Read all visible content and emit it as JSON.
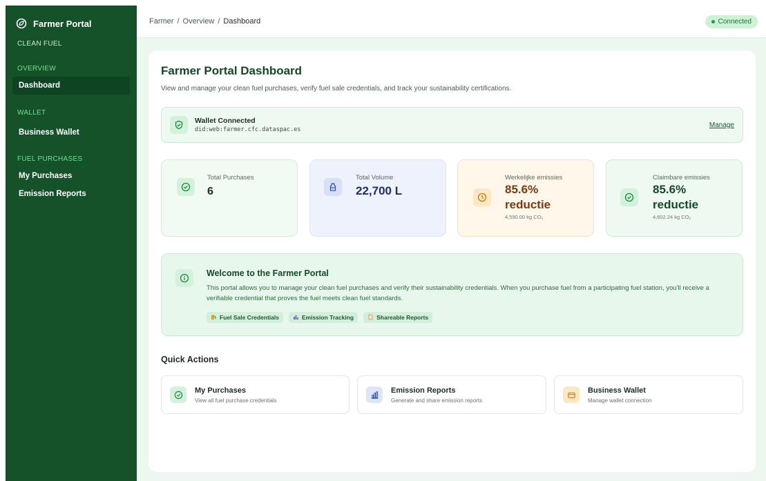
{
  "app": {
    "name": "Farmer Portal"
  },
  "colors": {
    "sidebar": "#15522a",
    "accent": "#6fe08f",
    "connected": "#1aa047",
    "volume_tint": "#eef2fd",
    "actual_emissions_tint": "#fff8ea",
    "claimable_emissions_tint": "#eefaf1"
  },
  "sidebar": {
    "top_section": "CLEAN FUEL",
    "sections": [
      {
        "label": "OVERVIEW",
        "items": [
          {
            "label": "Dashboard",
            "active": true
          }
        ]
      },
      {
        "label": "WALLET",
        "items": [
          {
            "label": "Business Wallet"
          }
        ]
      },
      {
        "label": "FUEL PURCHASES",
        "items": [
          {
            "label": "My Purchases"
          },
          {
            "label": "Emission Reports"
          }
        ]
      }
    ]
  },
  "header": {
    "breadcrumb": [
      "Farmer",
      "Overview",
      "Dashboard"
    ],
    "separator": "/",
    "status": "Connected"
  },
  "page": {
    "title": "Farmer Portal Dashboard",
    "subtitle": "View and manage your clean fuel purchases, verify fuel sale credentials, and track your sustainability certifications."
  },
  "wallet": {
    "title": "Wallet Connected",
    "did": "did:web:farmer.cfc.dataspac.es",
    "manage": "Manage",
    "icon": "shield-check-icon"
  },
  "stats": [
    {
      "label": "Total Purchases",
      "value": "6",
      "icon": "check-circle-icon"
    },
    {
      "label": "Total Volume",
      "value": "22,700 L",
      "icon": "bottle-icon"
    },
    {
      "label": "Werkelijke emissies",
      "value": "85.6%",
      "value2": "reductie",
      "sub": "4,590.00 kg CO₂",
      "icon": "clock-icon"
    },
    {
      "label": "Claimbare emissies",
      "value": "85.6%",
      "value2": "reductie",
      "sub": "4,602.24 kg CO₂",
      "icon": "check-circle-icon"
    }
  ],
  "welcome": {
    "title": "Welcome to the Farmer Portal",
    "body": "This portal allows you to manage your clean fuel purchases and verify their sustainability credentials. When you purchase fuel from a participating fuel station, you'll receive a verifiable credential that proves the fuel meets clean fuel standards.",
    "icon": "info-icon",
    "tags": [
      {
        "label": "Fuel Sale Credentials",
        "icon": "fuel-pump-icon"
      },
      {
        "label": "Emission Tracking",
        "icon": "bar-chart-icon"
      },
      {
        "label": "Shareable Reports",
        "icon": "document-icon"
      }
    ]
  },
  "quick_actions": {
    "title": "Quick Actions",
    "items": [
      {
        "title": "My Purchases",
        "desc": "View all fuel purchase credentials",
        "icon": "check-circle-icon"
      },
      {
        "title": "Emission Reports",
        "desc": "Generate and share emission reports",
        "icon": "bar-chart-icon"
      },
      {
        "title": "Business Wallet",
        "desc": "Manage wallet connection",
        "icon": "wallet-icon"
      }
    ]
  }
}
